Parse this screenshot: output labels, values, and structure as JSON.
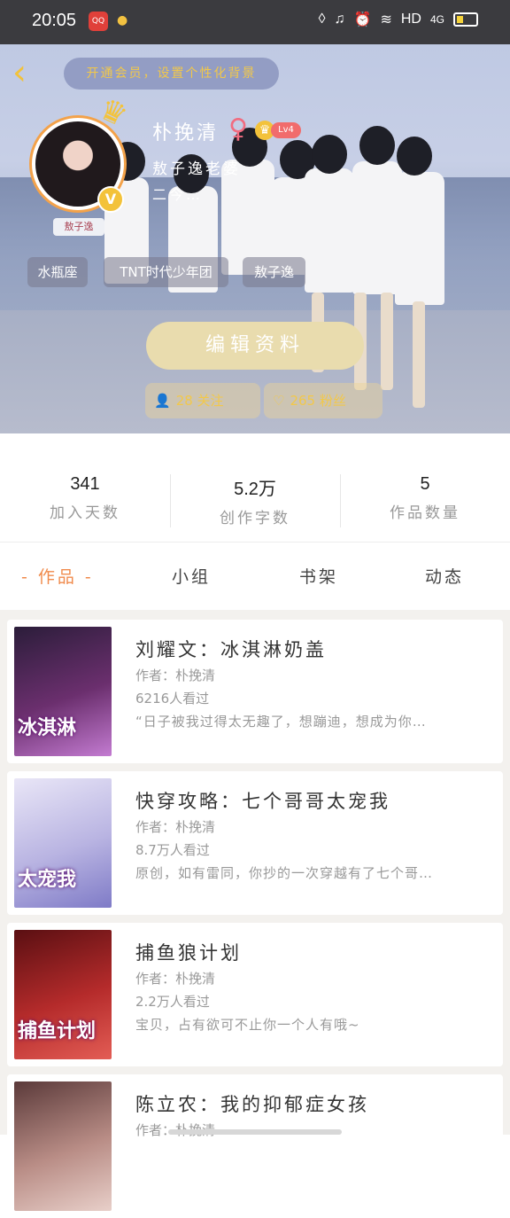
{
  "status_bar": {
    "time": "20:05",
    "app1_label": "QQ",
    "network": "HD",
    "signal": "4G"
  },
  "hero": {
    "vip_banner": "开通会员，设置个性化背景",
    "avatar_tag": "敖子逸",
    "username": "朴挽清",
    "level": "Lv4",
    "subtitle1": "敖子逸老婆",
    "subtitle2": "二今…",
    "tags": [
      "水瓶座",
      "TNT时代少年团",
      "敖子逸"
    ],
    "edit_button": "编辑资料",
    "following": "28 关注",
    "fans": "265 粉丝"
  },
  "stats": [
    {
      "value": "341",
      "label": "加入天数"
    },
    {
      "value": "5.2万",
      "label": "创作字数"
    },
    {
      "value": "5",
      "label": "作品数量"
    }
  ],
  "tabs": [
    "- 作品 -",
    "小组",
    "书架",
    "动态"
  ],
  "works": [
    {
      "title": "刘耀文：冰淇淋奶盖",
      "author": "作者：朴挽清",
      "views": "6216人看过",
      "desc": "“日子被我过得太无趣了，想蹦迪，想成为你…",
      "cover_text": "冰淇淋",
      "cover_colors": [
        "#2b1d3a",
        "#6b2f6e",
        "#c37bd1"
      ]
    },
    {
      "title": "快穿攻略：七个哥哥太宠我",
      "author": "作者：朴挽清",
      "views": "8.7万人看过",
      "desc": "原创，如有雷同，你抄的一次穿越有了七个哥…",
      "cover_text": "太宠我",
      "cover_colors": [
        "#e9e6f7",
        "#b9b4e2",
        "#7f7bc7"
      ]
    },
    {
      "title": "捕鱼狼计划",
      "author": "作者：朴挽清",
      "views": "2.2万人看过",
      "desc": "宝贝，占有欲可不止你一个人有哦~",
      "cover_text": "捕鱼计划",
      "cover_colors": [
        "#5a0f12",
        "#b52b2b",
        "#e35d55"
      ]
    },
    {
      "title": "陈立农：我的抑郁症女孩",
      "author": "作者：朴挽清",
      "views": "",
      "desc": "",
      "cover_text": "",
      "cover_colors": [
        "#5b3a3a",
        "#b98d86",
        "#e8cfc9"
      ]
    }
  ]
}
